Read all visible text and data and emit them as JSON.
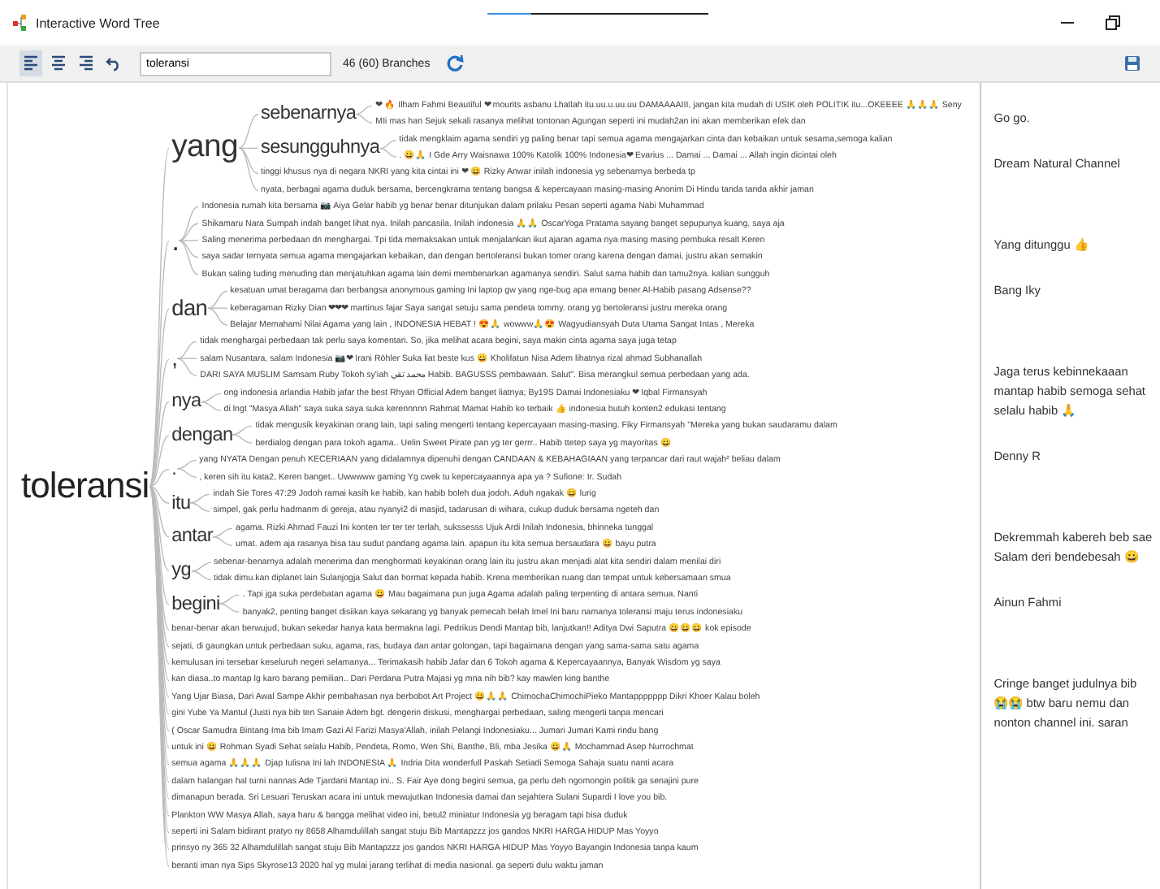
{
  "window": {
    "title": "Interactive Word Tree",
    "loading": {
      "level": 0.2
    }
  },
  "toolbar": {
    "buttons": [
      {
        "kind": "align-left",
        "selected": true
      },
      {
        "kind": "align-center",
        "selected": false
      },
      {
        "kind": "align-right",
        "selected": false
      },
      {
        "kind": "undo",
        "selected": false
      }
    ],
    "search": {
      "value": "toleransi"
    },
    "count": "46 (60) Branches"
  },
  "tree": {
    "word": "toleransi",
    "children": [
      {
        "kind": "group",
        "word": "yang",
        "children": [
          {
            "kind": "group",
            "word": "sebenarnya",
            "children": [
              {
                "kind": "leaf",
                "text": "❤ 🔥 Ilham Fahmi Beautiful ❤ mourits asbanu Lhatlah itu.uu.u.uu.uu DAMAAAAIII, jangan kita mudah di USIK oleh POLITIK itu...OKEEEE 🙏🙏🙏 Seny"
              },
              {
                "kind": "leaf",
                "text": "MIi mas han Sejuk sekali rasanya melihat tontonan Agungan seperti ini mudah2an ini akan memberikan efek dan"
              }
            ]
          },
          {
            "kind": "group",
            "word": "sesungguhnya",
            "children": [
              {
                "kind": "leaf",
                "text": "tidak mengklaim agama sendiri yg paling benar tapi semua agama mengajarkan cinta dan kebaikan untuk sesama,semoga kalian"
              },
              {
                "kind": "leaf",
                "text": ". 😀🙏 I Gde Arry Waisnawa 100% Katolik 100% Indonesia❤ Evarius ... Damai ... Damai ... Allah ingin dicintai oleh"
              }
            ]
          },
          {
            "kind": "leaf",
            "text": "tinggi khusus nya di negara NKRI yang kita cintai ini ❤ 😀 Rizky Anwar inilah indonesia yg sebenarnya berbeda tp"
          },
          {
            "kind": "leaf",
            "text": "nyata, berbagai agama duduk bersama, bercengkrama tentang bangsa & kepercayaan masing-masing Anonim Di Hindu tanda tanda akhir jaman"
          }
        ]
      },
      {
        "kind": "group",
        "word": ".",
        "children": [
          {
            "kind": "leaf",
            "text": "Indonesia rumah kita bersama 📷 Aiya Gelar habib yg benar benar ditunjukan dalam prilaku Pesan seperti agama Nabi Muhammad"
          },
          {
            "kind": "leaf",
            "text": "Shikamaru Nara Sumpah indah banget lihat nya. Inilah pancasila. Inilah indonesia 🙏🙏 OscarYoga Pratama sayang banget sepupunya kuang, saya aja"
          },
          {
            "kind": "leaf",
            "text": "Saling menerima perbedaan dn menghargai. Tpi tida memaksakan untuk menjalankan ikut ajaran agama nya masing masing pembuka resalt Keren"
          },
          {
            "kind": "leaf",
            "text": "saya sadar ternyata semua agama mengajarkan kebaikan, dan dengan bertoleransi bukan tomer orang karena dengan damai, justru akan semakin"
          },
          {
            "kind": "leaf",
            "text": "Bukan saling tuding menuding dan menjatuhkan agama lain demi membenarkan agamanya sendiri. Salut sama habib dan tamu2nya. kalian sungguh"
          }
        ]
      },
      {
        "kind": "group",
        "word": "dan",
        "children": [
          {
            "kind": "leaf",
            "text": "kesatuan umat beragama dan berbangsa anonymous gaming Ini laptop gw yang nge-bug apa emang bener Al-Habib pasang Adsense??"
          },
          {
            "kind": "leaf",
            "text": "keberagaman Rizky Dian ❤❤❤ martinus fajar Saya sangat setuju sama pendeta tommy. orang yg bertoleransi justru mereka orang"
          },
          {
            "kind": "leaf",
            "text": "Belajar Memahami Nilai Agama yang lain , INDONESIA HEBAT ! 😍🙏 wowww🙏😍 Wagyudiansyah Duta Utama Sangat Intas , Mereka"
          }
        ]
      },
      {
        "kind": "group",
        "word": ",",
        "children": [
          {
            "kind": "leaf",
            "text": "tidak menghargai perbedaan tak perlu saya komentari. So, jika melihat acara begini, saya makin cinta agama saya juga tetap"
          },
          {
            "kind": "leaf",
            "text": "salam Nusantara, salam Indonesia 📷❤ Irani Röhler Suka liat beste kus 😀 Kholifatun Nisa Adem lihatnya rizal ahmad Subhanallah"
          },
          {
            "kind": "leaf",
            "text": "DARI SAYA MUSLIM Samsam Ruby Tokoh sy'iah محمد تقي Habib. BAGUSSS pembawaan. Salut\". Bisa merangkul semua perbedaan yang ada."
          }
        ]
      },
      {
        "kind": "group",
        "word": "nya",
        "children": [
          {
            "kind": "leaf",
            "text": "ong indonesia arlandia Habib jafar the best Rhyan Official Adem banget liatnya; By19S Damai Indonesiaku ❤ Iqbal Firmansyah"
          },
          {
            "kind": "leaf",
            "text": "di lngt \"Masya Allah\" saya suka saya suka kerennnnn Rahmat Mamat Habib ko terbaik 👍 indonesia butuh konten2 edukasi tentang"
          }
        ]
      },
      {
        "kind": "group",
        "word": "dengan",
        "children": [
          {
            "kind": "leaf",
            "text": "tidak mengusik keyakinan orang lain, tapi saling mengerti tentang kepercayaan masing-masing. Fiky Firmansyah \"Mereka yang bukan saudaramu dalam"
          },
          {
            "kind": "leaf",
            "text": "berdialog dengan para tokoh agama.. Uelin Sweet Pirate pan yg ter gerrr.. Habib ttetep saya yg mayoritas 😀"
          }
        ]
      },
      {
        "kind": "group",
        "word": ".",
        "children": [
          {
            "kind": "leaf",
            "text": "yang NYATA Dengan penuh KECERIAAN yang didalamnya dipenuhi dengan CANDAAN & KEBAHAGIAAN yang terpancar dari raut wajah² beliau dalam"
          },
          {
            "kind": "leaf",
            "text": ", keren sih itu kata2, Keren banget.. Uwwwww gaming Yg cwek tu kepercayaannya apa ya ? Sufione: Ir. Sudah"
          }
        ]
      },
      {
        "kind": "group",
        "word": "itu",
        "children": [
          {
            "kind": "leaf",
            "text": "indah Sie Tores 47:29 Jodoh ramai kasih ke habib, kan habib boleh dua jodoh. Aduh ngakak 😀 lurig"
          },
          {
            "kind": "leaf",
            "text": "simpel, gak perlu hadmanm di gereja, atau nyanyi2 di masjid, tadarusan di wihara, cukup duduk bersama ngeteh dan"
          }
        ]
      },
      {
        "kind": "group",
        "word": "antar",
        "children": [
          {
            "kind": "leaf",
            "text": "agama. Rizki Ahmad Fauzi Ini konten ter ter ter terlah, sukssesss Ujuk Ardi Inilah Indonesia, bhinneka tunggal"
          },
          {
            "kind": "leaf",
            "text": "umat. adem aja rasanya bisa tau sudut pandang agama lain. apapun itu kita semua bersaudara 😀 bayu putra"
          }
        ]
      },
      {
        "kind": "group",
        "word": "yg",
        "children": [
          {
            "kind": "leaf",
            "text": "sebenar-benarnya adalah menerima dan menghormati keyakinan orang lain itu justru akan menjadi alat kita sendiri dalam menilai diri"
          },
          {
            "kind": "leaf",
            "text": "tidak dimu.kan diplanet lain Sulanjogja Salut dan hormat kepada habib. Krena memberikan ruang dan tempat untuk kebersamaan smua"
          }
        ]
      },
      {
        "kind": "group",
        "word": "begini",
        "children": [
          {
            "kind": "leaf",
            "text": ". Tapi jga suka perdebatan agama 😀 Mau bagaimana pun juga Agama adalah paling terpenting di antara semua. Nanti"
          },
          {
            "kind": "leaf",
            "text": "banyak2, penting banget disiikan kaya sekarang yg banyak pemecah belah Imel Ini baru namanya toleransi maju terus indonesiaku"
          }
        ]
      },
      {
        "kind": "leaf",
        "text": "benar-benar akan berwujud, bukan sekedar hanya kata bermakna lagi. Pedrikus Dendi Mantap bib, lanjutkan!! Aditya Dwi Saputra 😀😀😀 kok episode"
      },
      {
        "kind": "leaf",
        "text": "sejati, di gaungkan untuk perbedaan suku, agama, ras, budaya dan antar golongan, tapi bagaimana dengan yang sama-sama satu agama"
      },
      {
        "kind": "leaf",
        "text": "kemulusan ini tersebar keseluruh negeri selamanya... Terimakasih habib Jafar dan 6 Tokoh agama & Kepercayaannya, Banyak Wisdom yg saya"
      },
      {
        "kind": "leaf",
        "text": "kan diasa..to mantap lg karo barang pemilian.. Dari Perdana Putra Majasi yg mna nih bib? kay mawlen king banthe"
      },
      {
        "kind": "leaf",
        "text": "Yang Ujar Biasa, Dari Awal Sampe Akhir pembahasan nya berbobot Art Project 😀🙏🙏 ChimochaChimochiPieko Mantappppppp Dikri Khoer Kalau boleh"
      },
      {
        "kind": "leaf",
        "text": "gini Yube Ya Mantul (Justi nya bib ten Sanaie Adem bgt. dengerin diskusi, menghargai perbedaan, saling mengerti tanpa mencari"
      },
      {
        "kind": "leaf",
        "text": "( Oscar Samudra Bintang Ima bib Imam Gazi Al Farizi Masya'Allah, inilah Pelangi Indonesiaku... Jumari Jumari Kami rindu bang"
      },
      {
        "kind": "leaf",
        "text": "untuk ini 😀 Rohman Syadi Sehat selalu Habib, Pendeta, Romo, Wen Shi, Banthe, Bli, mba Jesika 😀🙏 Mochammad Asep Nurrochmat"
      },
      {
        "kind": "leaf",
        "text": "semua agama 🙏🙏🙏 Djap Iulisna Ini lah INDONESIA 🙏 Indria Dita wonderfull Paskah Setiadi Semoga Sahaja suatu nanti acara"
      },
      {
        "kind": "leaf",
        "text": "dalam halangan hal turni nannas Ade Tjardani Mantap ini.. S. Fair Aye dong begini semua, ga perlu deh ngomongin politik ga senajini pure"
      },
      {
        "kind": "leaf",
        "text": "dimanapun berada. Sri Lesuari Teruskan acara ini untuk mewujutkan Indonesia damai dan sejahtera Sulani Supardi I love you bib."
      },
      {
        "kind": "leaf",
        "text": "Plankton WW Masya Allah, saya haru & bangga melihat video ini, betul2 miniatur Indonesia yg beragam tapi bisa duduk"
      },
      {
        "kind": "leaf",
        "text": "seperti ini Salam bidirant pratyo ny 8658 Alhamdulillah sangat stuju Bib Mantapzzz jos gandos NKRI HARGA HIDUP Mas Yoyyo"
      },
      {
        "kind": "leaf",
        "text": "prinsyo ny 365 32 Alhamdulillah sangat stuju Bib Mantapzzz jos gandos NKRI HARGA HIDUP Mas Yoyyo Bayangin Indonesia tanpa kaum"
      },
      {
        "kind": "leaf",
        "text": "beranti iman nya Sips Skyrose13 2020 hal yg mulai jarang terlihat di media nasional. ga seperti dulu waktu jaman"
      }
    ]
  },
  "comments": [
    {
      "text": "Go go.",
      "author": "Dream Natural Channel"
    },
    {
      "text": "Yang ditunggu 👍",
      "author": "Bang Iky"
    },
    {
      "text": "Jaga terus kebinnekaaan mantap habib semoga sehat selalu habib 🙏",
      "author": "Denny R"
    },
    {
      "text": "Dekremmah kabereh beb sae Salam deri bendebesah 😀",
      "author": "Ainun Fahmi"
    },
    {
      "text": "Cringe banget judulnya bib 😭😭 btw baru nemu dan nonton channel ini. saran"
    }
  ]
}
